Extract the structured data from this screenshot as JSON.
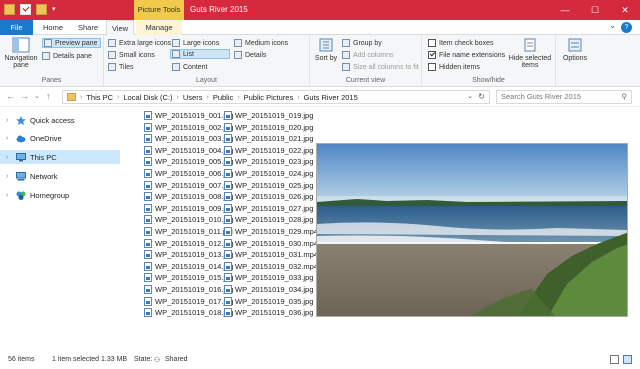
{
  "title_bar": {
    "context_tab": "Picture Tools",
    "window_title": "Guts River 2015",
    "controls": [
      "—",
      "☐",
      "✕"
    ]
  },
  "ribbon_tabs": {
    "file": "File",
    "home": "Home",
    "share": "Share",
    "view": "View",
    "manage": "Manage"
  },
  "ribbon": {
    "panes": {
      "navigation_pane": "Navigation pane",
      "preview_pane": "Preview pane",
      "details_pane": "Details pane",
      "group_label": "Panes"
    },
    "layout": {
      "extra_large_icons": "Extra large icons",
      "large_icons": "Large icons",
      "medium_icons": "Medium icons",
      "small_icons": "Small icons",
      "list": "List",
      "details": "Details",
      "tiles": "Tiles",
      "content": "Content",
      "group_label": "Layout"
    },
    "current_view": {
      "sort_by": "Sort by",
      "group_by": "Group by",
      "add_columns": "Add columns",
      "size_all_columns": "Size all columns to fit",
      "group_label": "Current view"
    },
    "show_hide": {
      "item_check_boxes": "Item check boxes",
      "file_name_extensions": "File name extensions",
      "hidden_items": "Hidden items",
      "hide_selected_items": "Hide selected items",
      "group_label": "Show/hide"
    },
    "options": "Options"
  },
  "address_bar": {
    "crumbs": [
      "This PC",
      "Local Disk (C:)",
      "Users",
      "Public",
      "Public Pictures",
      "Guts River 2015"
    ],
    "search_placeholder": "Search Guts River 2015"
  },
  "nav_pane": {
    "items": [
      "Quick access",
      "OneDrive",
      "This PC",
      "Network",
      "Homegroup"
    ]
  },
  "files": {
    "column1": [
      "WP_20151019_001.jpg",
      "WP_20151019_002.jpg",
      "WP_20151019_003.jpg",
      "WP_20151019_004.jpg",
      "WP_20151019_005.jpg",
      "WP_20151019_006.jpg",
      "WP_20151019_007.jpg",
      "WP_20151019_008.jpg",
      "WP_20151019_009.jpg",
      "WP_20151019_010.jpg",
      "WP_20151019_011.jpg",
      "WP_20151019_012.jpg",
      "WP_20151019_013.jpg",
      "WP_20151019_014.jpg",
      "WP_20151019_015.jpg",
      "WP_20151019_016.jpg",
      "WP_20151019_017.jpg",
      "WP_20151019_018.jpg"
    ],
    "column2": [
      "WP_20151019_019.jpg",
      "WP_20151019_020.jpg",
      "WP_20151019_021.jpg",
      "WP_20151019_022.jpg",
      "WP_20151019_023.jpg",
      "WP_20151019_024.jpg",
      "WP_20151019_025.jpg",
      "WP_20151019_026.jpg",
      "WP_20151019_027.jpg",
      "WP_20151019_028.jpg",
      "WP_20151019_029.mp4",
      "WP_20151019_030.mp4",
      "WP_20151019_031.mp4",
      "WP_20151019_032.mp4",
      "WP_20151019_033.jpg",
      "WP_20151019_034.jpg",
      "WP_20151019_035.jpg",
      "WP_20151019_036.jpg"
    ]
  },
  "status_bar": {
    "item_count": "56 items",
    "selection": "1 item selected  1.33 MB",
    "state_label": "State:",
    "state_value": "Shared"
  }
}
